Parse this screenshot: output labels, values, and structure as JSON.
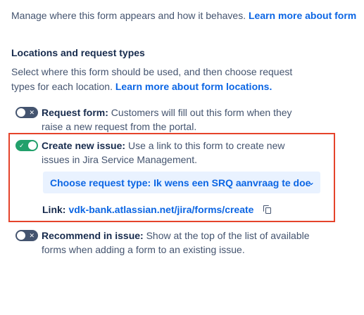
{
  "intro": {
    "text": "Manage where this form appears and how it behaves.",
    "link": "Learn more about form"
  },
  "section": {
    "title": "Locations and request types",
    "desc_line1": "Select where this form should be used, and then choose request",
    "desc_line2": "types for each location.",
    "desc_link": "Learn more about form locations."
  },
  "options": {
    "request_form": {
      "enabled": false,
      "label": "Request form:",
      "line1": "Customers will fill out this form when they",
      "line2": "raise a new request from the portal."
    },
    "create_issue": {
      "enabled": true,
      "label": "Create new issue:",
      "line1": "Use a link to this form to create new",
      "line2": "issues in Jira Service Management.",
      "request_type_label": "Choose request type:",
      "request_type_value": "Ik wens een SRQ aanvraag te doe",
      "link_label": "Link:",
      "link_url": "vdk-bank.atlassian.net/jira/forms/create"
    },
    "recommend": {
      "enabled": false,
      "label": "Recommend in issue:",
      "line1": "Show at the top of the list of available",
      "line2": "forms when adding a form to an existing issue."
    }
  },
  "icons": {
    "toggle_off_mark": "✕",
    "toggle_on_mark": "✓",
    "chevron": "⌄"
  },
  "colors": {
    "link": "#0c66e4",
    "toggle_on": "#22a06b",
    "toggle_off": "#44546f",
    "highlight": "#e5432b"
  }
}
